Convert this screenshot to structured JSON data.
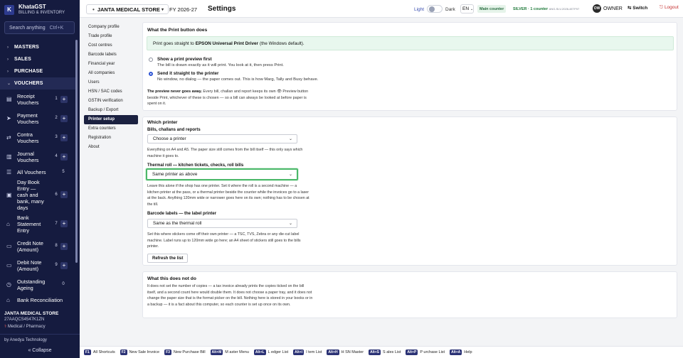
{
  "app": {
    "title": "KhataGST",
    "subtitle": "BILLING & INVENTORY",
    "logo_letter": "K"
  },
  "search": {
    "placeholder": "Search anything",
    "shortcut": "Ctrl+K"
  },
  "sidebar": {
    "sections": [
      {
        "label": "MASTERS"
      },
      {
        "label": "SALES"
      },
      {
        "label": "PURCHASE"
      },
      {
        "label": "VOUCHERS"
      }
    ],
    "items": [
      {
        "label": "Receipt Vouchers",
        "count": "1"
      },
      {
        "label": "Payment Vouchers",
        "count": "2"
      },
      {
        "label": "Contra Vouchers",
        "count": "3"
      },
      {
        "label": "Journal Vouchers",
        "count": "4"
      },
      {
        "label": "All Vouchers",
        "count": "5"
      },
      {
        "label": "Day Book Entry — cash and bank, many days",
        "count": "6"
      },
      {
        "label": "Bank Statement Entry",
        "count": "7"
      },
      {
        "label": "Credit Note (Amount)",
        "count": "8"
      },
      {
        "label": "Debit Note (Amount)",
        "count": "9"
      },
      {
        "label": "Outstanding Ageing",
        "count": "0"
      },
      {
        "label": "Bank Reconciliation",
        "count": ""
      }
    ],
    "company": {
      "name": "JANTA MEDICAL STORE",
      "gstin": "27AAQCS4547K1ZN",
      "type": "Medical / Pharmacy"
    },
    "footer": "by Anedya Technology",
    "collapse": "« Collapse"
  },
  "header": {
    "store": "JANTA MEDICAL STORE",
    "fy": "FY 2026-27",
    "title": "Settings",
    "theme_light": "Light",
    "theme_dark": "Dark",
    "language": "EN",
    "counter": "Main counter",
    "license_plan": "SILVER · 1 counter",
    "license_key": "ANG-SLV-2026-4E7F97",
    "avatar": "OW",
    "role": "OWNER",
    "switch": "⇆ Switch",
    "logout": "⎋ Logout"
  },
  "settings_nav": [
    "Company profile",
    "Trade profile",
    "Cost centres",
    "Barcode labels",
    "Financial year",
    "All companies",
    "Users",
    "HSN / SAC codes",
    "GSTIN verification",
    "Backup / Export",
    "Printer setup",
    "Extra counters",
    "Registration",
    "About"
  ],
  "settings_nav_active": "Printer setup",
  "print_button": {
    "title": "What the Print button does",
    "callout_pre": "Print goes straight to",
    "callout_printer": "EPSON Universal Print Driver",
    "callout_post": "(the Windows default).",
    "options": [
      {
        "title": "Show a print preview first",
        "desc": "The bill is drawn exactly as it will print. You look at it, then press Print.",
        "selected": false
      },
      {
        "title": "Send it straight to the printer",
        "desc": "No window, no dialog — the paper comes out. This is how Marg, Tally and Busy behave.",
        "selected": true
      }
    ],
    "note_bold": "The preview never goes away.",
    "note_rest": "Every bill, challan and report keeps its own 👁 Preview button beside Print, whichever of these is chosen — so a bill can always be looked at before paper is spent on it."
  },
  "which_printer": {
    "title": "Which printer",
    "bills_label": "Bills, challans and reports",
    "bills_value": "Choose a printer",
    "bills_help": "Everything on A4 and A5. The paper size still comes from the bill itself — this only says which machine it goes to.",
    "thermal_label": "Thermal roll — kitchen tickets, checks, roll bills",
    "thermal_value": "Same printer as above",
    "thermal_help": "Leave this alone if the shop has one printer. Set it where the roll is a second machine — a kitchen printer at the pass, or a thermal printer beside the counter while the invoices go to a laser at the back. Anything 120mm wide or narrower goes here on its own; nothing has to be chosen at the till.",
    "barcode_label": "Barcode labels — the label printer",
    "barcode_value": "Same as the thermal roll",
    "barcode_help": "Set this where stickers come off their own printer — a TSC, TVS, Zebra or any die-cut label machine. Label runs up to 120mm wide go here; an A4 sheet of stickers still goes to the bills printer.",
    "refresh": "Refresh the list"
  },
  "not_do": {
    "title": "What this does not do",
    "body": "It does not set the number of copies — a tax invoice already prints the copies ticked on the bill itself, and a second count here would double them. It does not choose a paper tray, and it does not change the paper size that is the format picker on the bill. Nothing here is stored in your books or in a backup — it is a fact about this computer, so each counter is set up once on its own."
  },
  "shortcuts": [
    {
      "key": "F1",
      "label": "All Shortcuts"
    },
    {
      "key": "F2",
      "label": "New Sale Invoice"
    },
    {
      "key": "F3",
      "label": "New Purchase Bill"
    },
    {
      "key": "Alt+M",
      "label": "M aster Menu"
    },
    {
      "key": "Alt+L",
      "label": "L edger List"
    },
    {
      "key": "Alt+I",
      "label": "I tem List"
    },
    {
      "key": "Alt+H",
      "label": "H SN Master"
    },
    {
      "key": "Alt+S",
      "label": "S ales List"
    },
    {
      "key": "Alt+P",
      "label": "P urchase List"
    },
    {
      "key": "Alt+A",
      "label": "Help"
    }
  ],
  "colors": {
    "sidebar_bg": "#151b3f",
    "accent": "#2f55d4",
    "success_bg": "#e8f7ee",
    "focus_ring": "#4cb86a",
    "logout": "#c53030"
  }
}
